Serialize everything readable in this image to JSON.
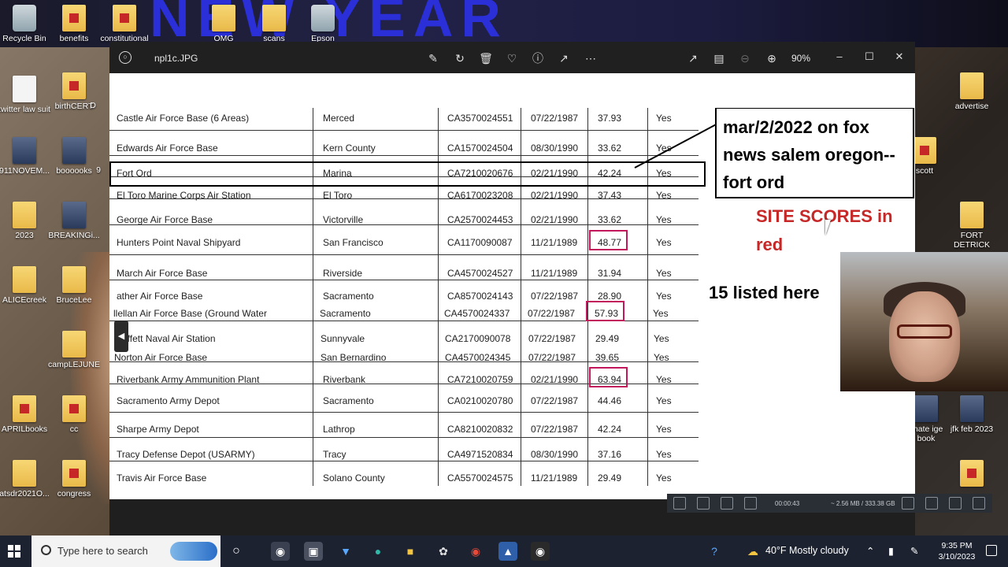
{
  "wallpaper": {
    "banner_text": "NEW YEAR"
  },
  "desktop_icons": [
    {
      "label": "Recycle Bin"
    },
    {
      "label": "benefits"
    },
    {
      "label": "constitutional"
    },
    {
      "label": "OMG"
    },
    {
      "label": "scans"
    },
    {
      "label": "Epson"
    },
    {
      "label": "twitter law suit"
    },
    {
      "label": "birthCERT"
    },
    {
      "label": "D"
    },
    {
      "label": "911NOVEM..."
    },
    {
      "label": "boooooks"
    },
    {
      "label": "9"
    },
    {
      "label": "2023"
    },
    {
      "label": "BREAKINGi..."
    },
    {
      "label": "ALICEcreek"
    },
    {
      "label": "BruceLee"
    },
    {
      "label": "campLEJUNE"
    },
    {
      "label": "APRILbooks"
    },
    {
      "label": "cc"
    },
    {
      "label": "atsdr2021O..."
    },
    {
      "label": "congress"
    },
    {
      "label": "advertise"
    },
    {
      "label": "scott"
    },
    {
      "label": "FORT DETRICK"
    },
    {
      "label": "imate ige book"
    },
    {
      "label": "jfk feb 2023"
    },
    {
      "label": ""
    }
  ],
  "viewer": {
    "file_name": "npl1c.JPG",
    "zoom": "90%",
    "toolbar_icons": [
      "edit-icon",
      "rotate-icon",
      "delete-icon",
      "favorite-icon",
      "info-icon",
      "share-icon",
      "more-icon"
    ],
    "right_icons": [
      "fullscreen-icon",
      "filmstrip-icon",
      "zoom-out-icon",
      "zoom-in-icon"
    ]
  },
  "table": {
    "rows": [
      {
        "name": "Castle Air Force Base (6 Areas)",
        "city": "Merced",
        "epa_id": "CA3570024551",
        "date": "07/22/1987",
        "score": "37.93",
        "final": "Yes"
      },
      {
        "name": "Edwards Air Force Base",
        "city": "Kern County",
        "epa_id": "CA1570024504",
        "date": "08/30/1990",
        "score": "33.62",
        "final": "Yes"
      },
      {
        "name": "Fort Ord",
        "city": "Marina",
        "epa_id": "CA7210020676",
        "date": "02/21/1990",
        "score": "42.24",
        "final": "Yes"
      },
      {
        "name": "El Toro Marine Corps Air Station",
        "city": "El Toro",
        "epa_id": "CA6170023208",
        "date": "02/21/1990",
        "score": "37.43",
        "final": "Yes"
      },
      {
        "name": "George Air Force Base",
        "city": "Victorville",
        "epa_id": "CA2570024453",
        "date": "02/21/1990",
        "score": "33.62",
        "final": "Yes"
      },
      {
        "name": "Hunters Point Naval Shipyard",
        "city": "San Francisco",
        "epa_id": "CA1170090087",
        "date": "11/21/1989",
        "score": "48.77",
        "final": "Yes"
      },
      {
        "name": "March Air Force Base",
        "city": "Riverside",
        "epa_id": "CA4570024527",
        "date": "11/21/1989",
        "score": "31.94",
        "final": "Yes"
      },
      {
        "name": "ather Air Force Base",
        "city": "Sacramento",
        "epa_id": "CA8570024143",
        "date": "07/22/1987",
        "score": "28.90",
        "final": "Yes"
      },
      {
        "name": "llellan Air Force Base (Ground Water",
        "city": "Sacramento",
        "epa_id": "CA4570024337",
        "date": "07/22/1987",
        "score": "57.93",
        "final": "Yes"
      },
      {
        "name": "Moffett Naval Air Station",
        "city": "Sunnyvale",
        "epa_id": "CA2170090078",
        "date": "07/22/1987",
        "score": "29.49",
        "final": "Yes"
      },
      {
        "name": "Norton Air Force Base",
        "city": "San Bernardino",
        "epa_id": "CA4570024345",
        "date": "07/22/1987",
        "score": "39.65",
        "final": "Yes"
      },
      {
        "name": "Riverbank Army Ammunition Plant",
        "city": "Riverbank",
        "epa_id": "CA7210020759",
        "date": "02/21/1990",
        "score": "63.94",
        "final": "Yes"
      },
      {
        "name": "Sacramento Army Depot",
        "city": "Sacramento",
        "epa_id": "CA0210020780",
        "date": "07/22/1987",
        "score": "44.46",
        "final": "Yes"
      },
      {
        "name": "Sharpe Army Depot",
        "city": "Lathrop",
        "epa_id": "CA8210020832",
        "date": "07/22/1987",
        "score": "42.24",
        "final": "Yes"
      },
      {
        "name": "Tracy Defense Depot (USARMY)",
        "city": "Tracy",
        "epa_id": "CA4971520834",
        "date": "08/30/1990",
        "score": "37.16",
        "final": "Yes"
      },
      {
        "name": "Travis Air Force Base",
        "city": "Solano County",
        "epa_id": "CA5570024575",
        "date": "11/21/1989",
        "score": "29.49",
        "final": "Yes"
      }
    ]
  },
  "annotations": {
    "note_lines": [
      "mar/2/2022 on fox",
      "news salem oregon--",
      "fort ord"
    ],
    "red_note_lines": [
      "SITE SCORES in",
      "red"
    ],
    "count_note": "15 listed here"
  },
  "recorder": {
    "time": "00:00:43",
    "size": "~ 2.56 MB / 333.38 GB"
  },
  "taskbar": {
    "search_placeholder": "Type here to search",
    "weather": "40°F  Mostly cloudy",
    "time": "9:35 PM",
    "date": "3/10/2023"
  }
}
